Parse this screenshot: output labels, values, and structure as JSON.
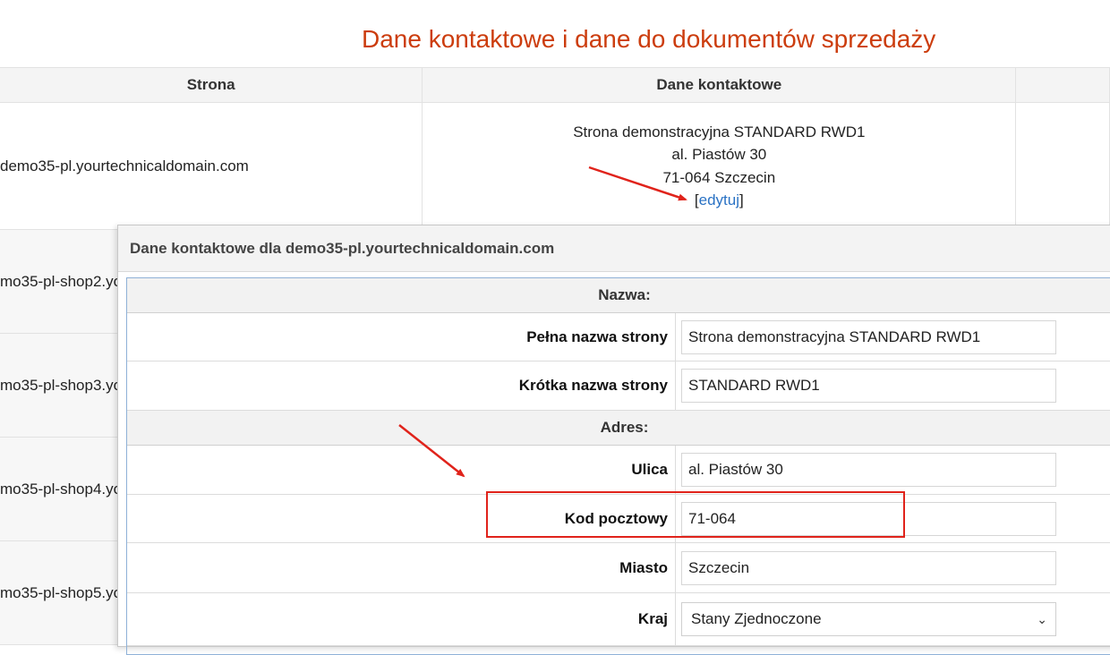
{
  "page": {
    "title": "Dane kontaktowe i dane do dokumentów sprzedaży"
  },
  "table": {
    "headers": {
      "site": "Strona",
      "contact": "Dane kontaktowe"
    },
    "rows": [
      {
        "site": "demo35-pl.yourtechnicaldomain.com"
      },
      {
        "site": "mo35-pl-shop2.yo"
      },
      {
        "site": "mo35-pl-shop3.yo"
      },
      {
        "site": "mo35-pl-shop4.yo"
      },
      {
        "site": "mo35-pl-shop5.yo"
      }
    ],
    "contact_block": {
      "line1": "Strona demonstracyjna STANDARD RWD1",
      "line2": "al. Piastów 30",
      "line3": "71-064 Szczecin",
      "bracket_open": "[",
      "edit_link": "edytuj",
      "bracket_close": "]"
    }
  },
  "modal": {
    "title": "Dane kontaktowe dla demo35-pl.yourtechnicaldomain.com",
    "section_name": "Nazwa:",
    "full_name_label": "Pełna nazwa strony",
    "full_name_value": "Strona demonstracyjna STANDARD RWD1",
    "short_name_label": "Krótka nazwa strony",
    "short_name_value": "STANDARD RWD1",
    "section_address": "Adres:",
    "street_label": "Ulica",
    "street_value": "al. Piastów 30",
    "postal_label": "Kod pocztowy",
    "postal_value": "71-064",
    "city_label": "Miasto",
    "city_value": "Szczecin",
    "country_label": "Kraj",
    "country_value": "Stany Zjednoczone"
  },
  "colors": {
    "title": "#cc3d0e",
    "link": "#2a72c4",
    "annotation": "#e0231b"
  }
}
